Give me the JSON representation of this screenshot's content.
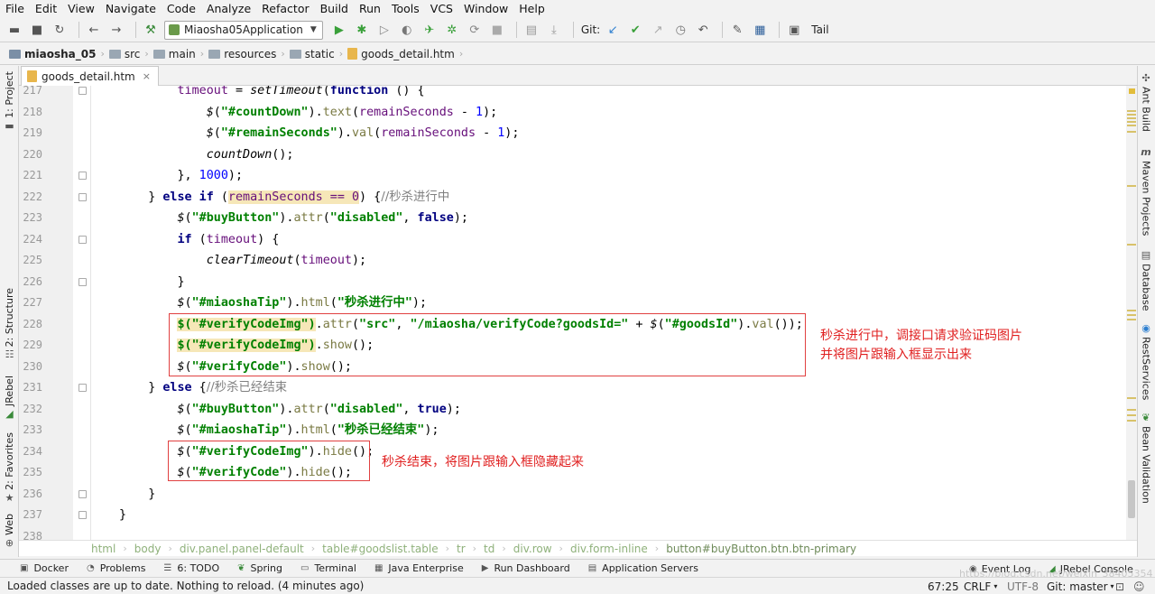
{
  "menu": [
    "File",
    "Edit",
    "View",
    "Navigate",
    "Code",
    "Analyze",
    "Refactor",
    "Build",
    "Run",
    "Tools",
    "VCS",
    "Window",
    "Help"
  ],
  "toolbar": {
    "run_config": "Miaosha05Application",
    "git_label": "Git:",
    "tail_label": "Tail"
  },
  "breadcrumb": [
    "miaosha_05",
    "src",
    "main",
    "resources",
    "static",
    "goods_detail.htm"
  ],
  "left_tabs": [
    "1: Project",
    "2: Structure",
    "JRebel",
    "2: Favorites",
    "Web"
  ],
  "right_tabs": [
    "Ant Build",
    "Maven Projects",
    "Database",
    "RestServices",
    "Bean Validation"
  ],
  "file_tab": {
    "label": "goods_detail.htm"
  },
  "line_numbers": [
    "217",
    "218",
    "219",
    "220",
    "221",
    "222",
    "223",
    "224",
    "225",
    "226",
    "227",
    "228",
    "229",
    "230",
    "231",
    "232",
    "233",
    "234",
    "235",
    "236",
    "237",
    "238"
  ],
  "code_lines": [
    [
      {
        "c": "timeout",
        "t": "id"
      },
      {
        "c": " = ",
        "t": ""
      },
      {
        "c": "setTimeout",
        "t": "fn"
      },
      {
        "c": "(",
        "t": ""
      },
      {
        "c": "function",
        "t": "kw"
      },
      {
        "c": " () {",
        "t": ""
      }
    ],
    [
      {
        "c": "$",
        "t": "fn"
      },
      {
        "c": "(",
        "t": ""
      },
      {
        "c": "\"#countDown\"",
        "t": "sel"
      },
      {
        "c": ").",
        "t": ""
      },
      {
        "c": "text",
        "t": "meth"
      },
      {
        "c": "(",
        "t": ""
      },
      {
        "c": "remainSeconds",
        "t": "id"
      },
      {
        "c": " - ",
        "t": ""
      },
      {
        "c": "1",
        "t": "num"
      },
      {
        "c": ");",
        "t": ""
      }
    ],
    [
      {
        "c": "$",
        "t": "fn"
      },
      {
        "c": "(",
        "t": ""
      },
      {
        "c": "\"#remainSeconds\"",
        "t": "sel"
      },
      {
        "c": ").",
        "t": ""
      },
      {
        "c": "val",
        "t": "meth"
      },
      {
        "c": "(",
        "t": ""
      },
      {
        "c": "remainSeconds",
        "t": "id"
      },
      {
        "c": " - ",
        "t": ""
      },
      {
        "c": "1",
        "t": "num"
      },
      {
        "c": ");",
        "t": ""
      }
    ],
    [
      {
        "c": "countDown",
        "t": "fn"
      },
      {
        "c": "();",
        "t": ""
      }
    ],
    [
      {
        "c": "}, ",
        "t": ""
      },
      {
        "c": "1000",
        "t": "num"
      },
      {
        "c": ");",
        "t": ""
      }
    ],
    [
      {
        "c": "} ",
        "t": ""
      },
      {
        "c": "else if",
        "t": "kw"
      },
      {
        "c": " (",
        "t": ""
      },
      {
        "c": "remainSeconds == 0",
        "t": "hl"
      },
      {
        "c": ") {",
        "t": ""
      },
      {
        "c": "//秒杀进行中",
        "t": "cmt"
      }
    ],
    [
      {
        "c": "$",
        "t": "fn"
      },
      {
        "c": "(",
        "t": ""
      },
      {
        "c": "\"#buyButton\"",
        "t": "sel"
      },
      {
        "c": ").",
        "t": ""
      },
      {
        "c": "attr",
        "t": "meth"
      },
      {
        "c": "(",
        "t": ""
      },
      {
        "c": "\"disabled\"",
        "t": "str"
      },
      {
        "c": ", ",
        "t": ""
      },
      {
        "c": "false",
        "t": "kw"
      },
      {
        "c": ");",
        "t": ""
      }
    ],
    [
      {
        "c": "if",
        "t": "kw"
      },
      {
        "c": " (",
        "t": ""
      },
      {
        "c": "timeout",
        "t": "id"
      },
      {
        "c": ") {",
        "t": ""
      }
    ],
    [
      {
        "c": "clearTimeout",
        "t": "fn"
      },
      {
        "c": "(",
        "t": ""
      },
      {
        "c": "timeout",
        "t": "id"
      },
      {
        "c": ");",
        "t": ""
      }
    ],
    [
      {
        "c": "}",
        "t": ""
      }
    ],
    [
      {
        "c": "$",
        "t": "fn"
      },
      {
        "c": "(",
        "t": ""
      },
      {
        "c": "\"#miaoshaTip\"",
        "t": "sel"
      },
      {
        "c": ").",
        "t": ""
      },
      {
        "c": "html",
        "t": "meth"
      },
      {
        "c": "(",
        "t": ""
      },
      {
        "c": "\"秒杀进行中\"",
        "t": "str"
      },
      {
        "c": ");",
        "t": ""
      }
    ],
    [
      {
        "c": "$(\"#verifyCodeImg\")",
        "t": "hlsel"
      },
      {
        "c": ".",
        "t": ""
      },
      {
        "c": "attr",
        "t": "meth"
      },
      {
        "c": "(",
        "t": ""
      },
      {
        "c": "\"src\"",
        "t": "str"
      },
      {
        "c": ", ",
        "t": ""
      },
      {
        "c": "\"/miaosha/verifyCode?goodsId=\"",
        "t": "str"
      },
      {
        "c": " + ",
        "t": ""
      },
      {
        "c": "$",
        "t": "fn"
      },
      {
        "c": "(",
        "t": ""
      },
      {
        "c": "\"#goodsId\"",
        "t": "sel"
      },
      {
        "c": ").",
        "t": ""
      },
      {
        "c": "val",
        "t": "meth"
      },
      {
        "c": "());",
        "t": ""
      }
    ],
    [
      {
        "c": "$(\"#verifyCodeImg\")",
        "t": "hlsel"
      },
      {
        "c": ".",
        "t": ""
      },
      {
        "c": "show",
        "t": "meth"
      },
      {
        "c": "();",
        "t": ""
      }
    ],
    [
      {
        "c": "$",
        "t": "fn"
      },
      {
        "c": "(",
        "t": ""
      },
      {
        "c": "\"#verifyCode\"",
        "t": "sel"
      },
      {
        "c": ").",
        "t": ""
      },
      {
        "c": "show",
        "t": "meth"
      },
      {
        "c": "();",
        "t": ""
      }
    ],
    [
      {
        "c": "} ",
        "t": ""
      },
      {
        "c": "else",
        "t": "kw"
      },
      {
        "c": " {",
        "t": ""
      },
      {
        "c": "//秒杀已经结束",
        "t": "cmt"
      }
    ],
    [
      {
        "c": "$",
        "t": "fn"
      },
      {
        "c": "(",
        "t": ""
      },
      {
        "c": "\"#buyButton\"",
        "t": "sel"
      },
      {
        "c": ").",
        "t": ""
      },
      {
        "c": "attr",
        "t": "meth"
      },
      {
        "c": "(",
        "t": ""
      },
      {
        "c": "\"disabled\"",
        "t": "str"
      },
      {
        "c": ", ",
        "t": ""
      },
      {
        "c": "true",
        "t": "kw"
      },
      {
        "c": ");",
        "t": ""
      }
    ],
    [
      {
        "c": "$",
        "t": "fn"
      },
      {
        "c": "(",
        "t": ""
      },
      {
        "c": "\"#miaoshaTip\"",
        "t": "sel"
      },
      {
        "c": ").",
        "t": ""
      },
      {
        "c": "html",
        "t": "meth"
      },
      {
        "c": "(",
        "t": ""
      },
      {
        "c": "\"秒杀已经结束\"",
        "t": "str"
      },
      {
        "c": ");",
        "t": ""
      }
    ],
    [
      {
        "c": "$",
        "t": "fn"
      },
      {
        "c": "(",
        "t": ""
      },
      {
        "c": "\"#verifyCodeImg\"",
        "t": "sel"
      },
      {
        "c": ").",
        "t": ""
      },
      {
        "c": "hide",
        "t": "meth"
      },
      {
        "c": "();",
        "t": ""
      }
    ],
    [
      {
        "c": "$",
        "t": "fn"
      },
      {
        "c": "(",
        "t": ""
      },
      {
        "c": "\"#verifyCode\"",
        "t": "sel"
      },
      {
        "c": ").",
        "t": ""
      },
      {
        "c": "hide",
        "t": "meth"
      },
      {
        "c": "();",
        "t": ""
      }
    ],
    [
      {
        "c": "}",
        "t": ""
      }
    ],
    [
      {
        "c": "}",
        "t": ""
      }
    ],
    [
      {
        "c": "",
        "t": ""
      }
    ]
  ],
  "annotations": {
    "note1_line1": "秒杀进行中，调接口请求验证码图片",
    "note1_line2": "并将图片跟输入框显示出来",
    "note2": "秒杀结束，将图片跟输入框隐藏起来"
  },
  "html_breadcrumb": [
    "html",
    "body",
    "div.panel.panel-default",
    "table#goodslist.table",
    "tr",
    "td",
    "div.row",
    "div.form-inline",
    "button#buyButton.btn.btn-primary"
  ],
  "bottom_tools": [
    "Docker",
    "Problems",
    "6: TODO",
    "Spring",
    "Terminal",
    "Java Enterprise",
    "Run Dashboard",
    "Application Servers"
  ],
  "bottom_tools_right": [
    "Event Log",
    "JRebel Console"
  ],
  "status": {
    "message": "Loaded classes are up to date. Nothing to reload. (4 minutes ago)",
    "position": "67:25",
    "line_sep": "CRLF",
    "encoding": "UTF-8",
    "git_branch": "Git: master"
  },
  "watermark": "https://blog.csdn.net/weixin_38405354"
}
